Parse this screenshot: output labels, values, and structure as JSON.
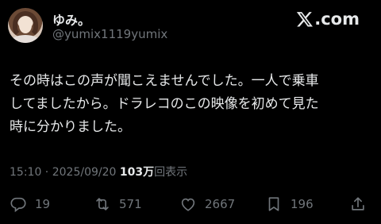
{
  "author": {
    "display_name": "ゆみ。",
    "handle": "@yumix1119yumix"
  },
  "brand": {
    "text": ".com"
  },
  "tweet": {
    "lines": [
      "その時はこの声が聞こえませんでした。一人で乗車",
      "してましたから。ドラレコのこの映像を初めて見た",
      "時に分かりました。"
    ]
  },
  "meta": {
    "time": "15:10",
    "separator": " · ",
    "date": "2025/09/20",
    "views_count": "103万",
    "views_label": "回表示"
  },
  "actions": {
    "replies": "19",
    "reposts": "571",
    "likes": "2667",
    "bookmarks": "196"
  },
  "colors": {
    "background": "#000000",
    "text": "#e7e9ea",
    "muted": "#71767b"
  },
  "icons": [
    "x-logo-icon",
    "reply-icon",
    "repost-icon",
    "like-icon",
    "bookmark-icon",
    "share-icon"
  ]
}
